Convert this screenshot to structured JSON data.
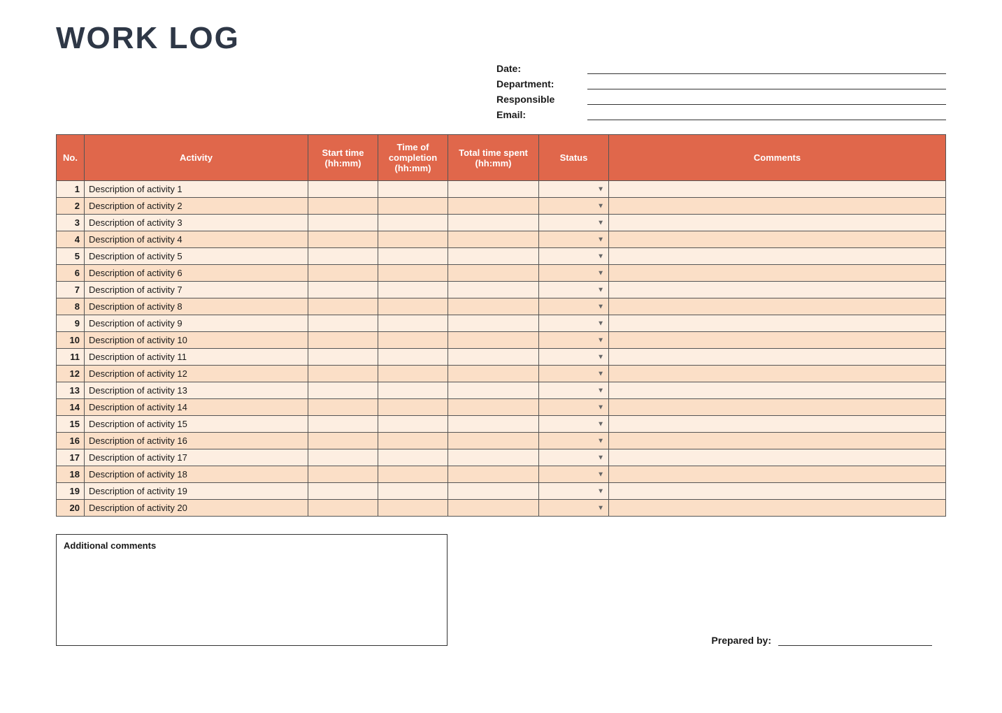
{
  "title": "WORK LOG",
  "info": {
    "date_label": "Date:",
    "department_label": "Department:",
    "responsible_label": "Responsible",
    "email_label": "Email:"
  },
  "table": {
    "headers": {
      "no": "No.",
      "activity": "Activity",
      "start": "Start time (hh:mm)",
      "end": "Time of completion (hh:mm)",
      "total": "Total time spent (hh:mm)",
      "status": "Status",
      "comments": "Comments"
    },
    "rows": [
      {
        "no": "1",
        "activity": "Description of activity 1",
        "start": "",
        "end": "",
        "total": "",
        "status": "",
        "comments": ""
      },
      {
        "no": "2",
        "activity": "Description of activity 2",
        "start": "",
        "end": "",
        "total": "",
        "status": "",
        "comments": ""
      },
      {
        "no": "3",
        "activity": "Description of activity 3",
        "start": "",
        "end": "",
        "total": "",
        "status": "",
        "comments": ""
      },
      {
        "no": "4",
        "activity": "Description of activity 4",
        "start": "",
        "end": "",
        "total": "",
        "status": "",
        "comments": ""
      },
      {
        "no": "5",
        "activity": "Description of activity 5",
        "start": "",
        "end": "",
        "total": "",
        "status": "",
        "comments": ""
      },
      {
        "no": "6",
        "activity": "Description of activity 6",
        "start": "",
        "end": "",
        "total": "",
        "status": "",
        "comments": ""
      },
      {
        "no": "7",
        "activity": "Description of activity 7",
        "start": "",
        "end": "",
        "total": "",
        "status": "",
        "comments": ""
      },
      {
        "no": "8",
        "activity": "Description of activity 8",
        "start": "",
        "end": "",
        "total": "",
        "status": "",
        "comments": ""
      },
      {
        "no": "9",
        "activity": "Description of activity 9",
        "start": "",
        "end": "",
        "total": "",
        "status": "",
        "comments": ""
      },
      {
        "no": "10",
        "activity": "Description of activity 10",
        "start": "",
        "end": "",
        "total": "",
        "status": "",
        "comments": ""
      },
      {
        "no": "11",
        "activity": "Description of activity 11",
        "start": "",
        "end": "",
        "total": "",
        "status": "",
        "comments": ""
      },
      {
        "no": "12",
        "activity": "Description of activity 12",
        "start": "",
        "end": "",
        "total": "",
        "status": "",
        "comments": ""
      },
      {
        "no": "13",
        "activity": "Description of activity 13",
        "start": "",
        "end": "",
        "total": "",
        "status": "",
        "comments": ""
      },
      {
        "no": "14",
        "activity": "Description of activity 14",
        "start": "",
        "end": "",
        "total": "",
        "status": "",
        "comments": ""
      },
      {
        "no": "15",
        "activity": "Description of activity 15",
        "start": "",
        "end": "",
        "total": "",
        "status": "",
        "comments": ""
      },
      {
        "no": "16",
        "activity": "Description of activity 16",
        "start": "",
        "end": "",
        "total": "",
        "status": "",
        "comments": ""
      },
      {
        "no": "17",
        "activity": "Description of activity 17",
        "start": "",
        "end": "",
        "total": "",
        "status": "",
        "comments": ""
      },
      {
        "no": "18",
        "activity": "Description of activity 18",
        "start": "",
        "end": "",
        "total": "",
        "status": "",
        "comments": ""
      },
      {
        "no": "19",
        "activity": "Description of activity 19",
        "start": "",
        "end": "",
        "total": "",
        "status": "",
        "comments": ""
      },
      {
        "no": "20",
        "activity": "Description of activity 20",
        "start": "",
        "end": "",
        "total": "",
        "status": "",
        "comments": ""
      }
    ]
  },
  "additional_comments_label": "Additional comments",
  "prepared_by_label": "Prepared by:"
}
